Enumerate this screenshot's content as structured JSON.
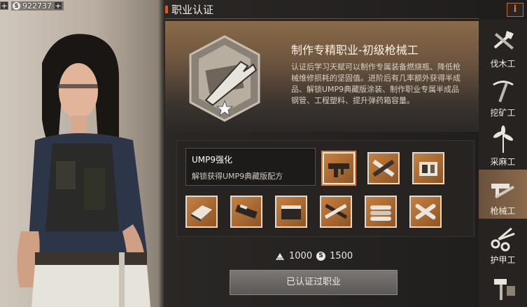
{
  "currency": {
    "amount": "922737"
  },
  "header": {
    "title": "职业认证",
    "info_icon": "i"
  },
  "profession": {
    "name": "制作专精职业-初级枪械工",
    "description": "认证后学习天赋可以制作专属装备燃烧瓶、降低枪械维修损耗的坚固值。进阶后有几率额外获得半成品、解锁UMP9典藏版涂装、制作职业专属半成品钢管、工程塑料、提升弹药箱容量。"
  },
  "recipe_tooltip": {
    "title": "UMP9强化",
    "subtitle": "解锁获得UMP9典藏版配方"
  },
  "recipes": [
    {
      "icon": "ump9-gun-icon",
      "selected": true
    },
    {
      "icon": "crossed-bars-icon",
      "selected": false
    },
    {
      "icon": "crate-icon",
      "selected": false
    },
    {
      "icon": "metal-sheet-icon",
      "selected": false
    },
    {
      "icon": "rifle-part-icon",
      "selected": false
    },
    {
      "icon": "ammo-box-icon",
      "selected": false
    },
    {
      "icon": "crossed-rifles-icon",
      "selected": false
    },
    {
      "icon": "steel-pipes-icon",
      "selected": false
    },
    {
      "icon": "crossed-pipes-icon",
      "selected": false
    }
  ],
  "cost": {
    "material": "1000",
    "silver": "1500",
    "material_icon": "ingot-icon",
    "silver_icon": "s-coin-icon"
  },
  "certify_button": "已认证过职业",
  "sidebar": {
    "items": [
      {
        "label": "伐木工",
        "icon": "axe-icon",
        "active": false
      },
      {
        "label": "挖矿工",
        "icon": "pickaxe-icon",
        "active": false
      },
      {
        "label": "采麻工",
        "icon": "plant-icon",
        "active": false
      },
      {
        "label": "枪械工",
        "icon": "gun-wrench-icon",
        "active": true
      },
      {
        "label": "护甲工",
        "icon": "scissors-icon",
        "active": false
      },
      {
        "label": "",
        "icon": "hammer-icon",
        "active": false
      }
    ]
  },
  "colors": {
    "accent": "#e07b32",
    "header_marker": "#d9582b",
    "active_tab": "#8b6a4b"
  }
}
